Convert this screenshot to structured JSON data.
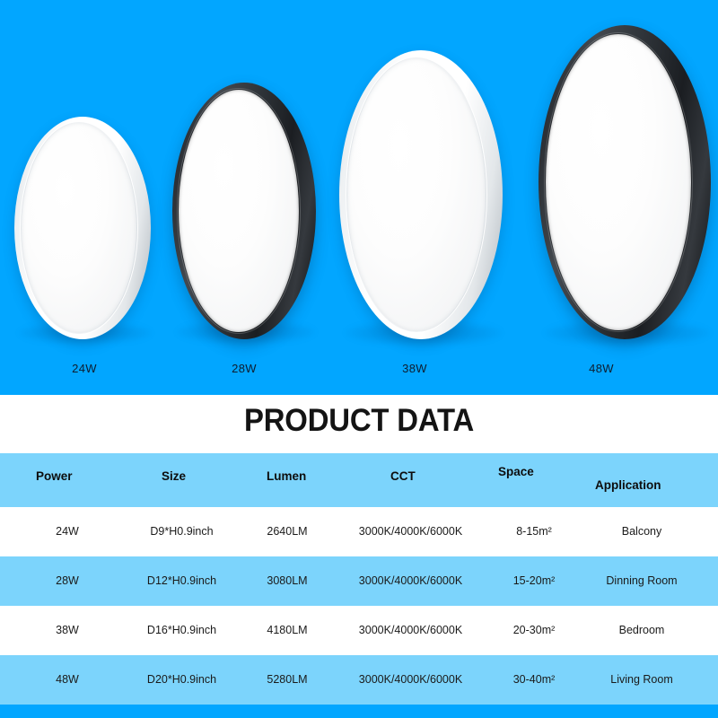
{
  "theme": {
    "background_blue": "#02A6FF",
    "row_blue": "#7CD4FC",
    "row_white": "#FFFFFF",
    "text_dark": "#1A1A1A"
  },
  "hero": {
    "products": [
      {
        "label": "24W",
        "rim": "white"
      },
      {
        "label": "28W",
        "rim": "black"
      },
      {
        "label": "38W",
        "rim": "white"
      },
      {
        "label": "48W",
        "rim": "black"
      }
    ]
  },
  "title": "PRODUCT DATA",
  "table": {
    "headers": [
      "Power",
      "Size",
      "Lumen",
      "CCT",
      "Space",
      "Application"
    ],
    "rows": [
      {
        "power": "24W",
        "size": "D9*H0.9inch",
        "lumen": "2640LM",
        "cct": "3000K/4000K/6000K",
        "space": "8-15m²",
        "application": "Balcony"
      },
      {
        "power": "28W",
        "size": "D12*H0.9inch",
        "lumen": "3080LM",
        "cct": "3000K/4000K/6000K",
        "space": "15-20m²",
        "application": "Dinning Room"
      },
      {
        "power": "38W",
        "size": "D16*H0.9inch",
        "lumen": "4180LM",
        "cct": "3000K/4000K/6000K",
        "space": "20-30m²",
        "application": "Bedroom"
      },
      {
        "power": "48W",
        "size": "D20*H0.9inch",
        "lumen": "5280LM",
        "cct": "3000K/4000K/6000K",
        "space": "30-40m²",
        "application": "Living Room"
      }
    ]
  }
}
